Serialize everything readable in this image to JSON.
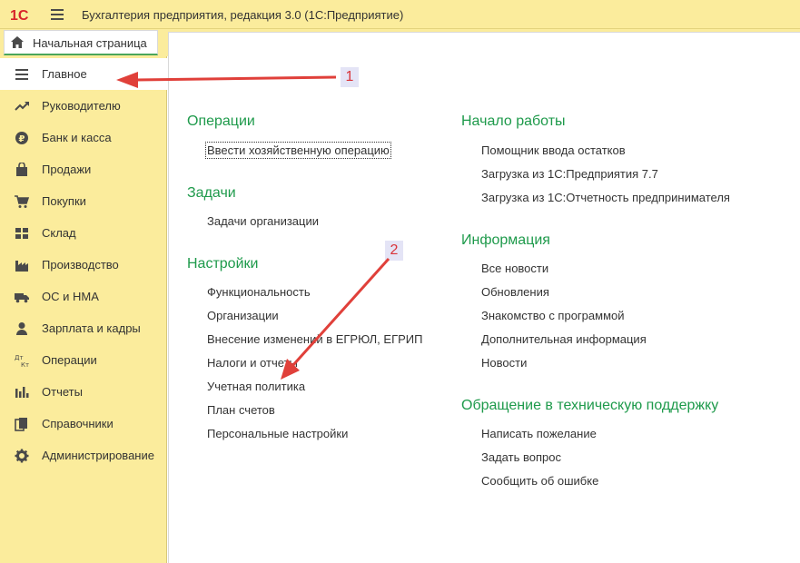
{
  "app": {
    "title": "Бухгалтерия предприятия, редакция 3.0  (1С:Предприятие)",
    "logo_text": "1С"
  },
  "tabs": {
    "home_label": "Начальная страница"
  },
  "sidebar": {
    "items": [
      {
        "label": "Главное",
        "icon": "list-icon",
        "active": true
      },
      {
        "label": "Руководителю",
        "icon": "trend-chart-icon",
        "active": false
      },
      {
        "label": "Банк и касса",
        "icon": "ruble-coin-icon",
        "active": false
      },
      {
        "label": "Продажи",
        "icon": "shopping-bag-icon",
        "active": false
      },
      {
        "label": "Покупки",
        "icon": "shopping-cart-icon",
        "active": false
      },
      {
        "label": "Склад",
        "icon": "warehouse-grid-icon",
        "active": false
      },
      {
        "label": "Производство",
        "icon": "factory-icon",
        "active": false
      },
      {
        "label": "ОС и НМА",
        "icon": "truck-icon",
        "active": false
      },
      {
        "label": "Зарплата и кадры",
        "icon": "person-icon",
        "active": false
      },
      {
        "label": "Операции",
        "icon": "debit-credit-icon",
        "active": false
      },
      {
        "label": "Отчеты",
        "icon": "bar-chart-icon",
        "active": false
      },
      {
        "label": "Справочники",
        "icon": "books-icon",
        "active": false
      },
      {
        "label": "Администрирование",
        "icon": "gear-icon",
        "active": false
      }
    ]
  },
  "left_column": {
    "operations": {
      "title": "Операции",
      "links": [
        "Ввести хозяйственную операцию"
      ]
    },
    "tasks": {
      "title": "Задачи",
      "links": [
        "Задачи организации"
      ]
    },
    "settings": {
      "title": "Настройки",
      "links": [
        "Функциональность",
        "Организации",
        "Внесение изменений в ЕГРЮЛ, ЕГРИП",
        "Налоги и отчеты",
        "Учетная политика",
        "План счетов",
        "Персональные настройки"
      ]
    }
  },
  "right_column": {
    "start": {
      "title": "Начало работы",
      "links": [
        "Помощник ввода остатков",
        "Загрузка из 1С:Предприятия 7.7",
        "Загрузка из 1С:Отчетность предпринимателя"
      ]
    },
    "info": {
      "title": "Информация",
      "links": [
        "Все новости",
        "Обновления",
        "Знакомство с программой",
        "Дополнительная информация",
        "Новости"
      ]
    },
    "support": {
      "title": "Обращение в техническую поддержку",
      "links": [
        "Написать пожелание",
        "Задать вопрос",
        "Сообщить об ошибке"
      ]
    }
  },
  "annotations": {
    "badge_1": "1",
    "badge_2": "2"
  },
  "colors": {
    "panel": "#fbec9c",
    "section_title": "#1e9a4b",
    "arrow": "#e0403a",
    "tab_underline": "#4aa65a"
  }
}
